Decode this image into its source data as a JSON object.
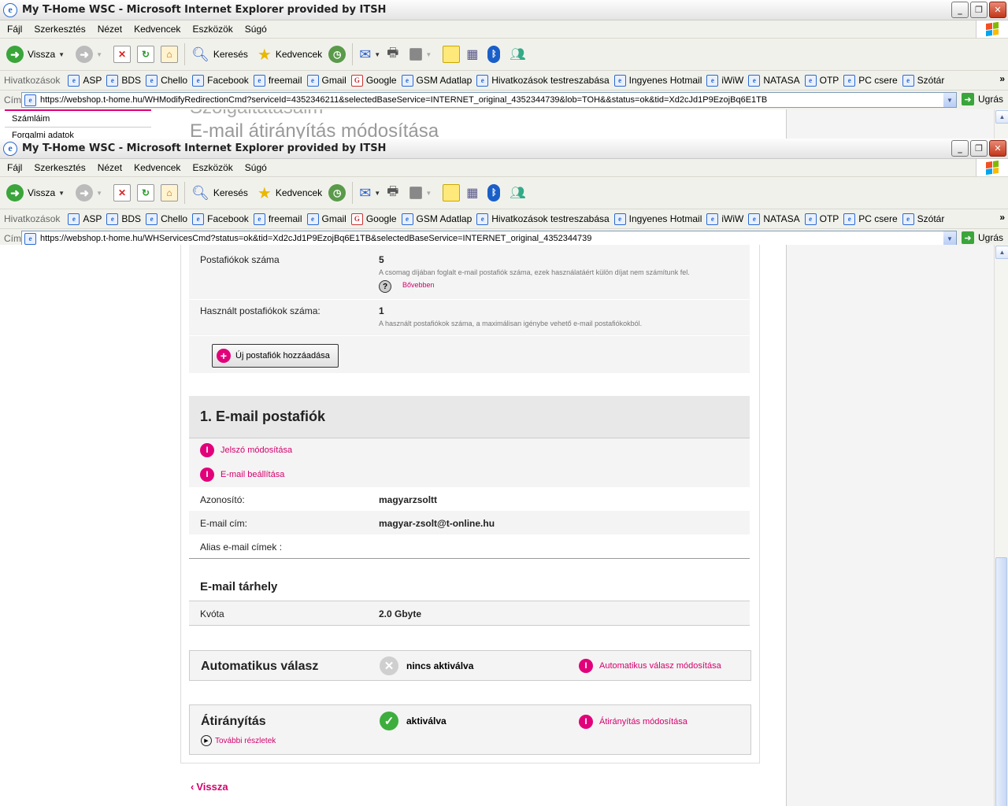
{
  "window1": {
    "title": "My T-Home WSC - Microsoft Internet Explorer provided by ITSH",
    "url": "https://webshop.t-home.hu/WHModifyRedirectionCmd?serviceId=4352346211&selectedBaseService=INTERNET_original_4352344739&lob=TOH&&status=ok&tid=Xd2cJd1P9EzojBq6E1TB",
    "behind": {
      "nav_items": [
        "Számláim",
        "Forgalmi adatok"
      ],
      "heading_top": "Szolgáltatásaim",
      "heading": "E-mail átirányítás módosítása"
    }
  },
  "window2": {
    "title": "My T-Home WSC - Microsoft Internet Explorer provided by ITSH",
    "url": "https://webshop.t-home.hu/WHServicesCmd?status=ok&tid=Xd2cJd1P9EzojBq6E1TB&selectedBaseService=INTERNET_original_4352344739"
  },
  "menu": [
    "Fájl",
    "Szerkesztés",
    "Nézet",
    "Kedvencek",
    "Eszközök",
    "Súgó"
  ],
  "toolbar": {
    "back": "Vissza",
    "search": "Keresés",
    "favorites": "Kedvencek"
  },
  "links": {
    "header": "Hivatkozások",
    "items": [
      "ASP",
      "BDS",
      "Chello",
      "Facebook",
      "freemail",
      "Gmail",
      "Google",
      "GSM Adatlap",
      "Hivatkozások testreszabása",
      "Ingyenes Hotmail",
      "iWiW",
      "NATASA",
      "OTP",
      "PC csere",
      "Szótár"
    ]
  },
  "address": {
    "label": "Cím",
    "go": "Ugrás"
  },
  "page": {
    "mailbox_count_label": "Postafiókok száma",
    "mailbox_count": "5",
    "mailbox_count_note": "A csomag díjában foglalt e-mail postafiók száma, ezek használatáért külön díjat nem számítunk fel.",
    "more": "Bővebben",
    "used_label": "Használt postafiókok száma:",
    "used": "1",
    "used_note": "A használt postafiókok száma, a maximálisan igénybe vehető e-mail postafiókokból.",
    "add_button": "Új postafiók hozzáadása",
    "box_title": "1. E-mail postafiók",
    "password_link": "Jelszó módosítása",
    "settings_link": "E-mail beállítása",
    "id_label": "Azonosító:",
    "id_value": "magyarzsoltt",
    "email_label": "E-mail cím:",
    "email_value": "magyar-zsolt@t-online.hu",
    "alias_label": "Alias e-mail címek :",
    "storage_title": "E-mail tárhely",
    "quota_label": "Kvóta",
    "quota_value": "2.0 Gbyte",
    "auto_title": "Automatikus válasz",
    "auto_status": "nincs aktiválva",
    "auto_link": "Automatikus válasz módosítása",
    "fwd_title": "Átirányítás",
    "fwd_status": "aktiválva",
    "fwd_link": "Átirányítás módosítása",
    "details": "További részletek",
    "back": "Vissza"
  },
  "colors": {
    "accent": "#e2007a",
    "link": "#d4006c"
  }
}
